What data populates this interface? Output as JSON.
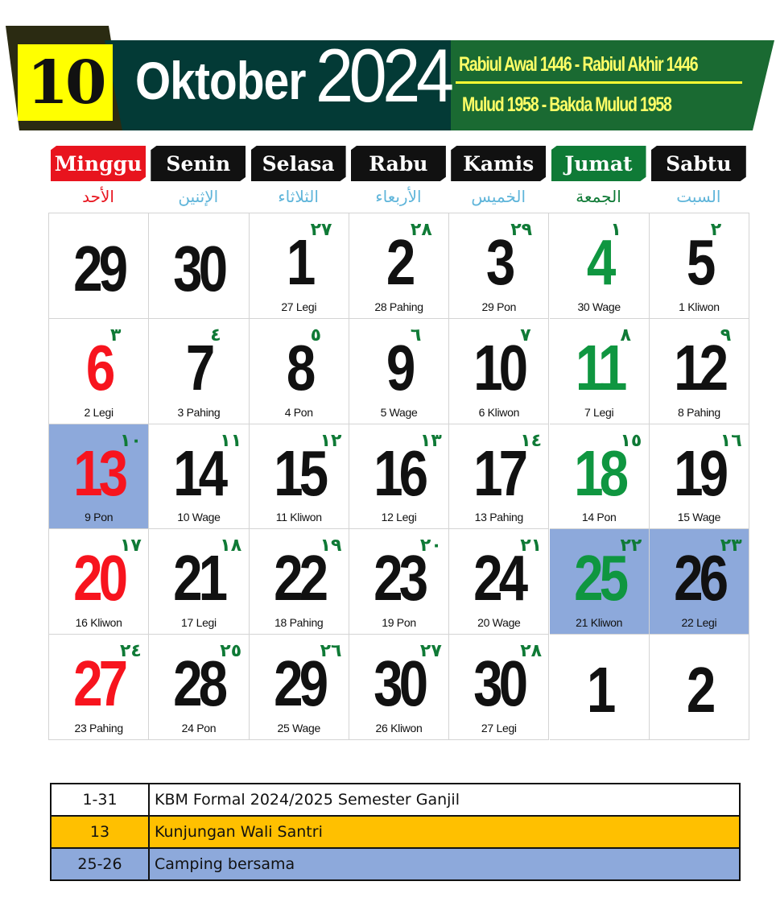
{
  "header": {
    "month_number": "10",
    "month_name": "Oktober",
    "year": "2024",
    "hijri": "Rabiul Awal 1446 - Rabiul Akhir 1446",
    "javanese": "Mulud 1958 - Bakda Mulud 1958"
  },
  "colors": {
    "banner": "#033a36",
    "hijri_band": "#1a6a32",
    "sunday": "#e8141e",
    "friday": "#0f7a36",
    "highlight": "#8da9db",
    "event_orange": "#ffc000"
  },
  "weekdays": [
    {
      "label": "Minggu",
      "arabic": "الأحد",
      "style": "red"
    },
    {
      "label": "Senin",
      "arabic": "الإثنين",
      "style": "black"
    },
    {
      "label": "Selasa",
      "arabic": "الثلاثاء",
      "style": "black"
    },
    {
      "label": "Rabu",
      "arabic": "الأربعاء",
      "style": "black"
    },
    {
      "label": "Kamis",
      "arabic": "الخميس",
      "style": "black"
    },
    {
      "label": "Jumat",
      "arabic": "الجمعة",
      "style": "green"
    },
    {
      "label": "Sabtu",
      "arabic": "السبت",
      "style": "black"
    }
  ],
  "weeks": [
    [
      {
        "day": "29",
        "hijri": "",
        "javanese": "",
        "color": "black",
        "highlight": false
      },
      {
        "day": "30",
        "hijri": "",
        "javanese": "",
        "color": "black",
        "highlight": false
      },
      {
        "day": "1",
        "hijri": "٢٧",
        "javanese": "27 Legi",
        "color": "black",
        "highlight": false
      },
      {
        "day": "2",
        "hijri": "٢٨",
        "javanese": "28 Pahing",
        "color": "black",
        "highlight": false
      },
      {
        "day": "3",
        "hijri": "٢٩",
        "javanese": "29 Pon",
        "color": "black",
        "highlight": false
      },
      {
        "day": "4",
        "hijri": "١",
        "javanese": "30 Wage",
        "color": "green",
        "highlight": false
      },
      {
        "day": "5",
        "hijri": "٢",
        "javanese": "1 Kliwon",
        "color": "black",
        "highlight": false
      }
    ],
    [
      {
        "day": "6",
        "hijri": "٣",
        "javanese": "2 Legi",
        "color": "red",
        "highlight": false
      },
      {
        "day": "7",
        "hijri": "٤",
        "javanese": "3 Pahing",
        "color": "black",
        "highlight": false
      },
      {
        "day": "8",
        "hijri": "٥",
        "javanese": "4 Pon",
        "color": "black",
        "highlight": false
      },
      {
        "day": "9",
        "hijri": "٦",
        "javanese": "5  Wage",
        "color": "black",
        "highlight": false
      },
      {
        "day": "10",
        "hijri": "٧",
        "javanese": "6  Kliwon",
        "color": "black",
        "highlight": false
      },
      {
        "day": "11",
        "hijri": "٨",
        "javanese": "7 Legi",
        "color": "green",
        "highlight": false
      },
      {
        "day": "12",
        "hijri": "٩",
        "javanese": "8 Pahing",
        "color": "black",
        "highlight": false
      }
    ],
    [
      {
        "day": "13",
        "hijri": "١٠",
        "javanese": "9 Pon",
        "color": "red",
        "highlight": true
      },
      {
        "day": "14",
        "hijri": "١١",
        "javanese": "10 Wage",
        "color": "black",
        "highlight": false
      },
      {
        "day": "15",
        "hijri": "١٢",
        "javanese": "11 Kliwon",
        "color": "black",
        "highlight": false
      },
      {
        "day": "16",
        "hijri": "١٣",
        "javanese": "12 Legi",
        "color": "black",
        "highlight": false
      },
      {
        "day": "17",
        "hijri": "١٤",
        "javanese": "13 Pahing",
        "color": "black",
        "highlight": false
      },
      {
        "day": "18",
        "hijri": "١٥",
        "javanese": "14 Pon",
        "color": "green",
        "highlight": false
      },
      {
        "day": "19",
        "hijri": "١٦",
        "javanese": "15 Wage",
        "color": "black",
        "highlight": false
      }
    ],
    [
      {
        "day": "20",
        "hijri": "١٧",
        "javanese": "16 Kliwon",
        "color": "red",
        "highlight": false
      },
      {
        "day": "21",
        "hijri": "١٨",
        "javanese": "17 Legi",
        "color": "black",
        "highlight": false
      },
      {
        "day": "22",
        "hijri": "١٩",
        "javanese": "18 Pahing",
        "color": "black",
        "highlight": false
      },
      {
        "day": "23",
        "hijri": "٢٠",
        "javanese": "19 Pon",
        "color": "black",
        "highlight": false
      },
      {
        "day": "24",
        "hijri": "٢١",
        "javanese": "20 Wage",
        "color": "black",
        "highlight": false
      },
      {
        "day": "25",
        "hijri": "٢٢",
        "javanese": "21 Kliwon",
        "color": "green",
        "highlight": true
      },
      {
        "day": "26",
        "hijri": "٢٣",
        "javanese": "22 Legi",
        "color": "black",
        "highlight": true
      }
    ],
    [
      {
        "day": "27",
        "hijri": "٢٤",
        "javanese": "23 Pahing",
        "color": "red",
        "highlight": false
      },
      {
        "day": "28",
        "hijri": "٢٥",
        "javanese": "24 Pon",
        "color": "black",
        "highlight": false
      },
      {
        "day": "29",
        "hijri": "٢٦",
        "javanese": "25 Wage",
        "color": "black",
        "highlight": false
      },
      {
        "day": "30",
        "hijri": "٢٧",
        "javanese": "26 Kliwon",
        "color": "black",
        "highlight": false
      },
      {
        "day": "30",
        "hijri": "٢٨",
        "javanese": "27 Legi",
        "color": "black",
        "highlight": false
      },
      {
        "day": "1",
        "hijri": "",
        "javanese": "",
        "color": "black",
        "highlight": false
      },
      {
        "day": "2",
        "hijri": "",
        "javanese": "",
        "color": "black",
        "highlight": false
      }
    ]
  ],
  "events": [
    {
      "dates": "1-31",
      "title": "KBM Formal 2024/2025 Semester Ganjil",
      "bg": "#ffffff"
    },
    {
      "dates": "13",
      "title": "Kunjungan Wali Santri",
      "bg": "#ffc000"
    },
    {
      "dates": "25-26",
      "title": "Camping bersama",
      "bg": "#8da9db"
    }
  ]
}
